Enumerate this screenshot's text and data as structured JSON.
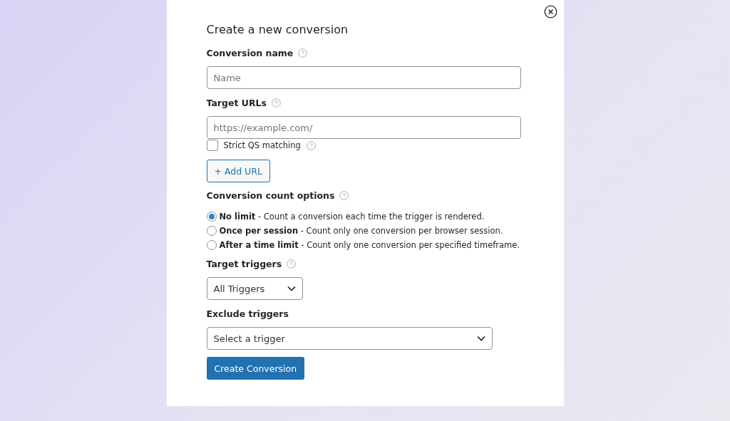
{
  "dialog": {
    "title": "Create a new conversion"
  },
  "conversion_name": {
    "label": "Conversion name",
    "placeholder": "Name"
  },
  "target_urls": {
    "label": "Target URLs",
    "placeholder": "https://example.com/",
    "strict_qs": {
      "label": "Strict QS matching",
      "checked": false
    },
    "add_button": "+ Add URL"
  },
  "count_options": {
    "label": "Conversion count options",
    "options": [
      {
        "text": "**No limit** - Count a conversion each time the trigger is rendered.",
        "selected": true
      },
      {
        "text": "**Once per session** - Count only one conversion per browser session.",
        "selected": false
      },
      {
        "text": "**After a time limit** - Count only one conversion per specified timeframe.",
        "selected": false
      }
    ]
  },
  "target_triggers": {
    "label": "Target triggers",
    "value": "All Triggers"
  },
  "exclude_triggers": {
    "label": "Exclude triggers",
    "value": "Select a trigger"
  },
  "submit_button": "Create Conversion"
}
